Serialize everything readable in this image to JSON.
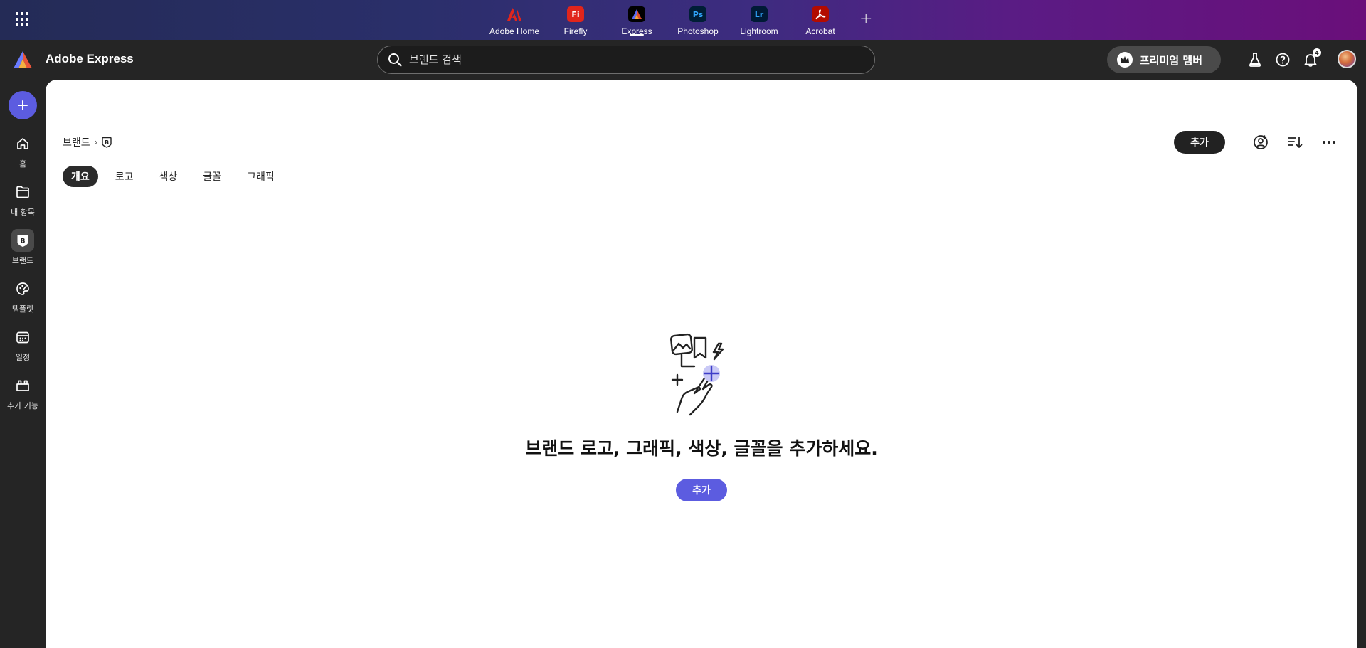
{
  "appbar": {
    "apps": [
      {
        "label": "Adobe Home",
        "icon": "adobe-home-icon",
        "color": "#e1251b"
      },
      {
        "label": "Firefly",
        "icon": "firefly-icon",
        "glyph": "Fi",
        "color": "#e1251b"
      },
      {
        "label": "Express",
        "icon": "express-icon",
        "color": "#000000"
      },
      {
        "label": "Photoshop",
        "icon": "photoshop-icon",
        "glyph": "Ps",
        "color": "#001e36"
      },
      {
        "label": "Lightroom",
        "icon": "lightroom-icon",
        "glyph": "Lr",
        "color": "#001a36"
      },
      {
        "label": "Acrobat",
        "icon": "acrobat-icon",
        "color": "#b30b00"
      }
    ],
    "active_app": "Express"
  },
  "header": {
    "product_name": "Adobe Express",
    "search_placeholder": "브랜드 검색",
    "premium_label": "프리미엄 멤버",
    "notification_count": "4"
  },
  "rail": {
    "items": [
      {
        "label": "홈",
        "icon": "home-icon"
      },
      {
        "label": "내 항목",
        "icon": "folder-icon"
      },
      {
        "label": "브랜드",
        "icon": "brand-icon",
        "active": true
      },
      {
        "label": "템플릿",
        "icon": "template-icon"
      },
      {
        "label": "일정",
        "icon": "calendar-icon"
      },
      {
        "label": "추가 기능",
        "icon": "add-ons-icon"
      }
    ]
  },
  "main": {
    "breadcrumb": "브랜드",
    "add_label": "추가",
    "tabs": [
      "개요",
      "로고",
      "색상",
      "글꼴",
      "그래픽"
    ],
    "active_tab": "개요",
    "empty_title": "브랜드 로고, 그래픽, 색상, 글꼴을 추가하세요.",
    "empty_add_label": "추가"
  },
  "colors": {
    "accent": "#5c5ce0",
    "rail_bg": "#252525"
  }
}
